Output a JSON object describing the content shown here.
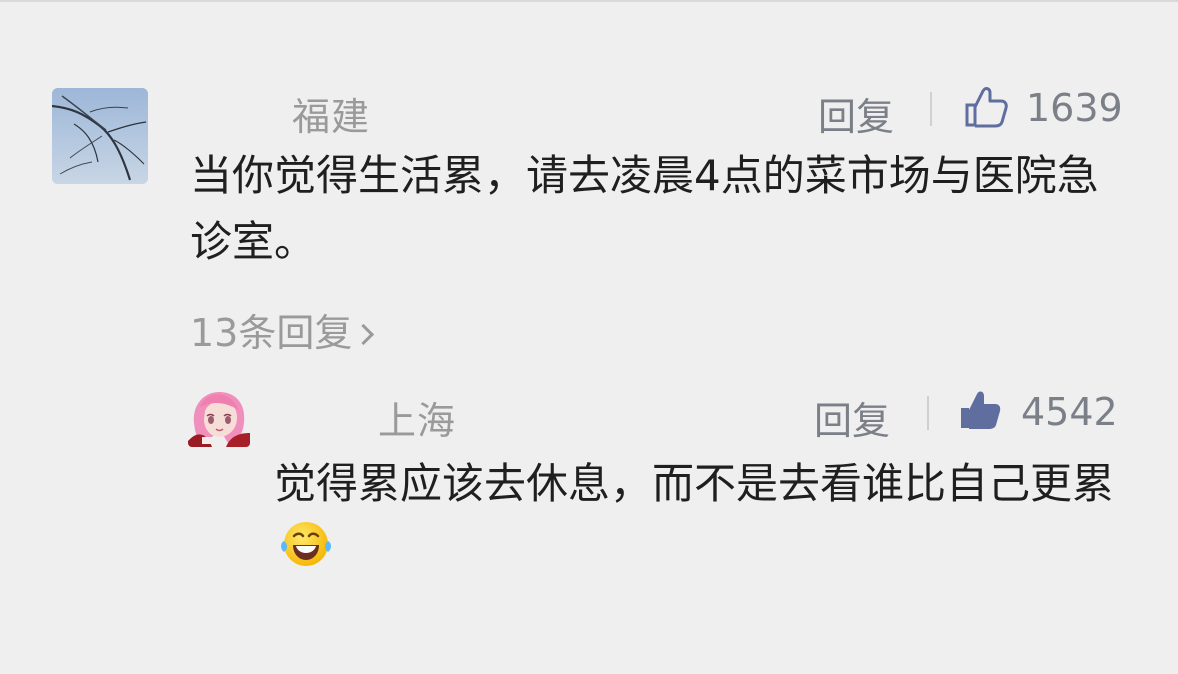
{
  "comments": {
    "main": {
      "author": "福建",
      "reply_label": "回复",
      "like_count": "1639",
      "text": "当你觉得生活累，请去凌晨4点的菜市场与医院急诊室。",
      "reply_count_label": "13条回复",
      "avatar_icon": "tree-branch-avatar-icon",
      "thumb_icon": "thumb-up-outline-icon"
    },
    "reply": {
      "author": "上海",
      "reply_label": "回复",
      "like_count": "4542",
      "text": "觉得累应该去休息，而不是去看谁比自己更累",
      "avatar_icon": "anime-girl-avatar-icon",
      "thumb_icon": "thumb-up-filled-icon",
      "emoji": "laughing-tears-emoji"
    }
  },
  "colors": {
    "background": "#efefef",
    "muted_text": "#9a9a9a",
    "action_text": "#7b7f87",
    "thumb_blue": "#5f6d9f"
  }
}
